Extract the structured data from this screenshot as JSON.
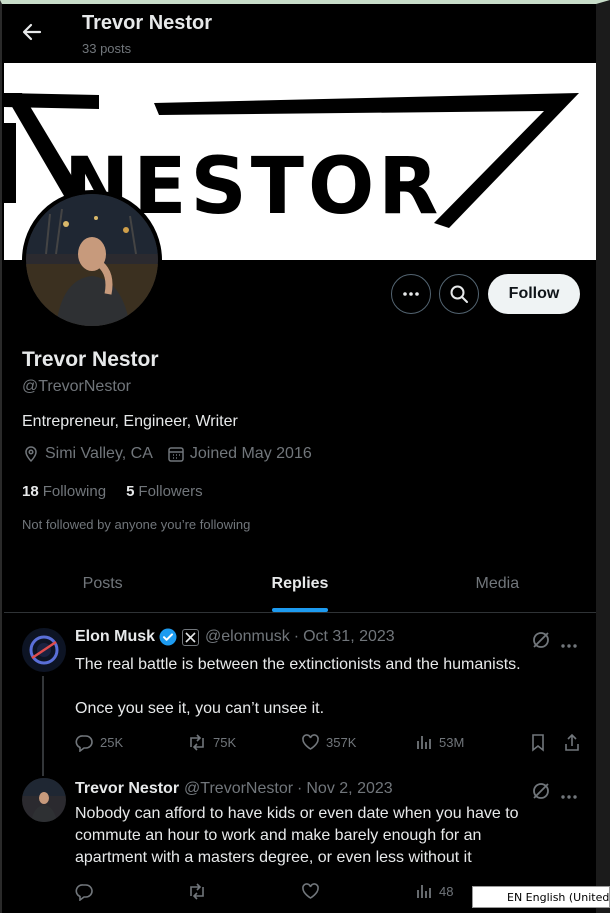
{
  "header": {
    "title": "Trevor Nestor",
    "post_count": "33 posts"
  },
  "banner": {
    "text": "NESTOR"
  },
  "profile": {
    "name": "Trevor Nestor",
    "handle": "@TrevorNestor",
    "bio": "Entrepreneur, Engineer, Writer",
    "location": "Simi Valley, CA",
    "joined": "Joined May 2016",
    "following_count": "18",
    "following_label": "Following",
    "followers_count": "5",
    "followers_label": "Followers",
    "not_followed": "Not followed by anyone you’re following",
    "follow_label": "Follow"
  },
  "tabs": [
    {
      "label": "Posts"
    },
    {
      "label": "Replies"
    },
    {
      "label": "Media"
    }
  ],
  "tweets": [
    {
      "name": "Elon Musk",
      "handle": "@elonmusk",
      "separator": "·",
      "date": "Oct 31, 2023",
      "text_line1": "The real battle is between the extinctionists and the humanists.",
      "text_line2": "Once you see it, you can’t unsee it.",
      "replies": "25K",
      "reposts": "75K",
      "likes": "357K",
      "views": "53M"
    },
    {
      "name": "Trevor Nestor",
      "handle": "@TrevorNestor",
      "separator": "·",
      "date": "Nov 2, 2023",
      "text_line1": "Nobody can afford to have kids or even date when you have to",
      "text_line2": "commute an hour to work and make barely enough for an",
      "text_line3": "apartment with a masters degree, or even less without it",
      "views": "48"
    }
  ],
  "taskbar": {
    "language": "EN English (United St"
  },
  "colors": {
    "accent": "#1d9bf0",
    "verified": "#1d9bf0",
    "background": "#000000",
    "muted": "#71767b"
  }
}
